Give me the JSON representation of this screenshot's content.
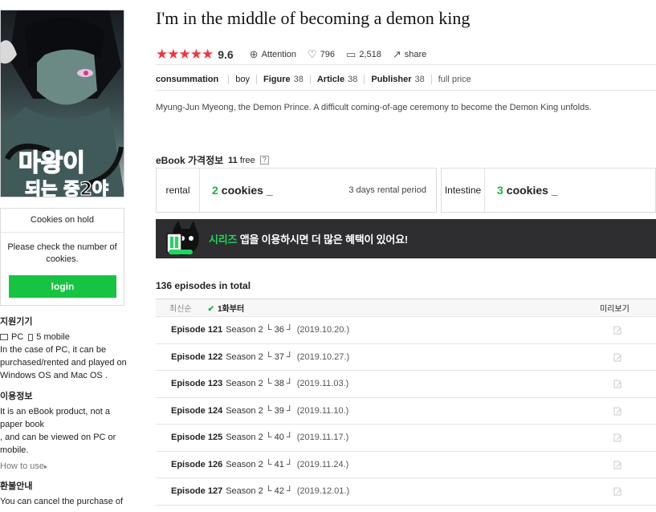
{
  "book": {
    "title": "I'm in the middle of becoming a demon king",
    "cover_title_line1": "마왕이",
    "cover_title_line2": "되는 중2야",
    "rating": "9.6",
    "attention_label": "Attention",
    "likes": "796",
    "comments": "2,518",
    "share_label": "share",
    "synopsis": "Myung-Jun Myeong, the Demon Prince. A difficult coming-of-age ceremony to become the Demon King unfolds."
  },
  "meta": {
    "status": "consummation",
    "genre": "boy",
    "figure_label": "Figure",
    "figure_value": "38",
    "article_label": "Article",
    "article_value": "38",
    "publisher_label": "Publisher",
    "publisher_value": "38",
    "price_type": "full price"
  },
  "hold": {
    "title": "Cookies on hold",
    "desc": "Please check the number of cookies.",
    "login_label": "login"
  },
  "left_info": {
    "support_title": "지원기기",
    "pc_label": "PC",
    "mobile_label": "5 mobile",
    "support_desc": "In the case of PC, it can be purchased/rented and played on Windows OS and Mac OS .",
    "usage_title": "이용정보",
    "usage_line1": "It is an eBook product, not a paper book",
    "usage_line2": ", and can be viewed on PC or mobile.",
    "how_to_use": "How to use",
    "refund_title": "환불안내",
    "refund_desc": "You can cancel the purchase of"
  },
  "ebook": {
    "head_label": "eBook 가격정보",
    "free_count": "11",
    "free_label": "free",
    "help": "?",
    "rental_label": "rental",
    "rental_num": "2",
    "rental_unit": "cookies _",
    "rental_period": "3 days rental period",
    "own_label": "Intestine",
    "own_num": "3",
    "own_unit": "cookies _"
  },
  "banner": {
    "highlight": "시리즈",
    "text": " 앱을 이용하시면 더 많은 혜택이 있어요!"
  },
  "episodes": {
    "count_text": "136 episodes in total",
    "sort_latest": "최신순",
    "sort_first": "1화부터",
    "preview_label": "미리보기",
    "rows": [
      {
        "name": "Episode 121",
        "sub": "Season 2 └ 36 ┘",
        "date": "(2019.10.20.)"
      },
      {
        "name": "Episode 122",
        "sub": "Season 2 └ 37 ┘",
        "date": "(2019.10.27.)"
      },
      {
        "name": "Episode 123",
        "sub": "Season 2 └ 38 ┘",
        "date": "(2019.11.03.)"
      },
      {
        "name": "Episode 124",
        "sub": "Season 2 └ 39 ┘",
        "date": "(2019.11.10.)"
      },
      {
        "name": "Episode 125",
        "sub": "Season 2 └ 40 ┘",
        "date": "(2019.11.17.)"
      },
      {
        "name": "Episode 126",
        "sub": "Season 2 └ 41 ┘",
        "date": "(2019.11.24.)"
      },
      {
        "name": "Episode 127",
        "sub": "Season 2 └ 42 ┘",
        "date": "(2019.12.01.)"
      }
    ]
  },
  "colors": {
    "accent_green": "#16c441",
    "star_red": "#f1353b",
    "banner_bg": "#2e2e30"
  }
}
